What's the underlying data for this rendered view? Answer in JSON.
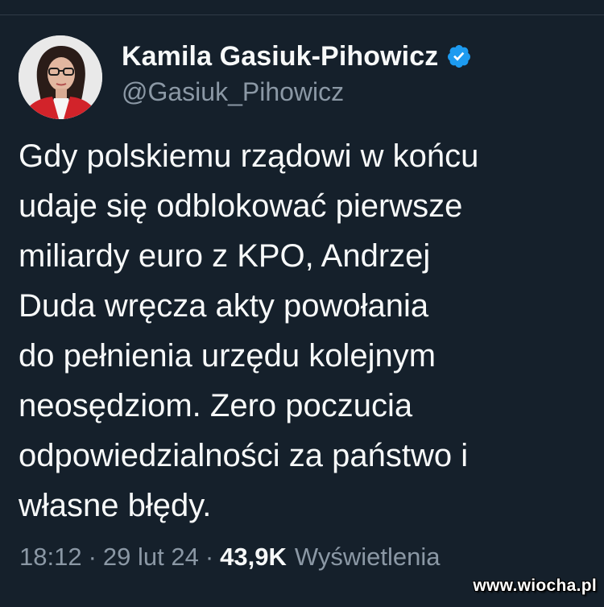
{
  "tweet": {
    "author": {
      "display_name": "Kamila Gasiuk-Pihowicz",
      "handle": "@Gasiuk_Pihowicz",
      "verified_icon": "verified-badge-icon",
      "avatar_icon": "profile-photo"
    },
    "body_lines": [
      "Gdy polskiemu rządowi w końcu",
      "udaje się odblokować pierwsze",
      "miliardy euro z KPO, Andrzej",
      "Duda wręcza akty powołania",
      "do pełnienia urzędu kolejnym",
      "neosędziom. Zero poczucia",
      "odpowiedzialności za państwo i",
      "własne błędy."
    ],
    "meta": {
      "time": "18:12",
      "separator": "·",
      "date": "29 lut 24",
      "views_count": "43,9K",
      "views_label": "Wyświetlenia"
    }
  },
  "watermark": "www.wiocha.pl",
  "colors": {
    "background": "#15202b",
    "text_primary": "#f7f9f9",
    "text_secondary": "#8b98a5",
    "verified_blue": "#1d9bf0"
  }
}
